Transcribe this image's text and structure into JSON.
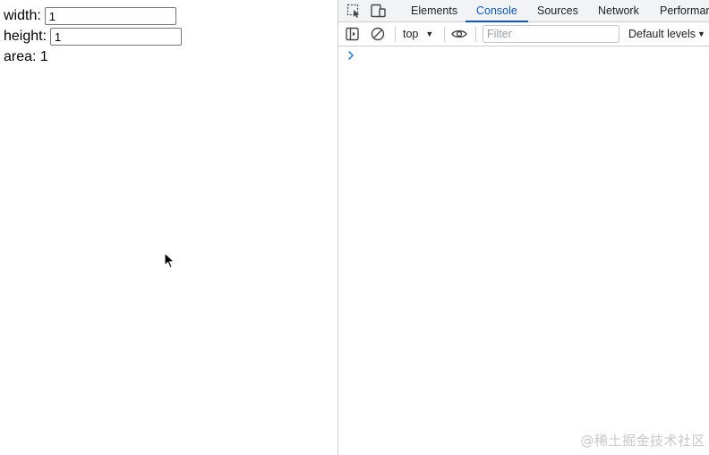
{
  "page": {
    "width_label": "width:",
    "width_value": "1",
    "height_label": "height:",
    "height_value": "1",
    "area_text": "area: 1"
  },
  "devtools": {
    "tabs": [
      "Elements",
      "Console",
      "Sources",
      "Network",
      "Performan"
    ],
    "active_tab": "Console",
    "context": "top",
    "filter_placeholder": "Filter",
    "levels_label": "Default levels",
    "accent_color": "#0b57d0"
  },
  "watermark": "@稀土掘金技术社区",
  "icons": [
    "inspect-element-icon",
    "device-toolbar-icon",
    "sidebar-toggle-icon",
    "clear-console-icon",
    "eye-icon",
    "console-prompt-chevron-icon",
    "mouse-cursor-icon"
  ]
}
